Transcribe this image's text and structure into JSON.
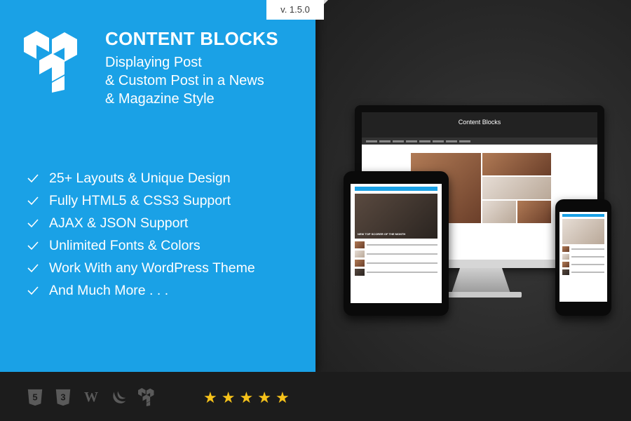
{
  "version": "v. 1.5.0",
  "product": {
    "title": "CONTENT BLOCKS",
    "subtitle_lines": [
      "Displaying Post",
      "& Custom Post in a News",
      "& Magazine Style"
    ]
  },
  "features": [
    "25+ Layouts & Unique Design",
    "Fully HTML5 & CSS3 Support",
    "AJAX & JSON Support",
    "Unlimited Fonts & Colors",
    "Work With any WordPress Theme",
    "And Much More . . ."
  ],
  "tech_icons": [
    "html5-icon",
    "css3-icon",
    "wordpress-icon",
    "jquery-icon",
    "content-blocks-logo-icon"
  ],
  "rating": {
    "stars": 5
  },
  "colors": {
    "accent": "#1aa1e6",
    "star": "#f6c21a",
    "dark": "#2b2b2b"
  },
  "preview": {
    "monitor_title": "Content Blocks",
    "tablet_post_title": "NEW TOP SCORER OF THE MONTH"
  }
}
